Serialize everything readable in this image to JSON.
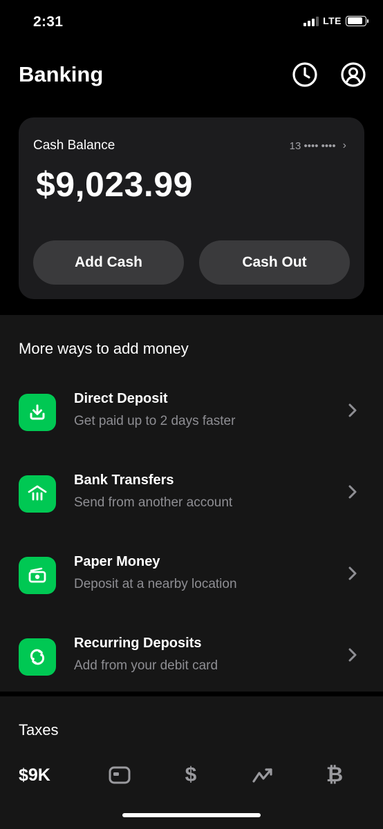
{
  "status_bar": {
    "time": "2:31",
    "network": "LTE",
    "battery_level": 0.85
  },
  "header": {
    "title": "Banking",
    "icons": [
      "history-icon",
      "profile-icon"
    ]
  },
  "balance_card": {
    "label": "Cash Balance",
    "account_mask": "13 •••• ••••",
    "amount": "$9,023.99",
    "add_cash_label": "Add Cash",
    "cash_out_label": "Cash Out"
  },
  "add_money": {
    "title": "More ways to add money",
    "items": [
      {
        "title": "Direct Deposit",
        "subtitle": "Get paid up to 2 days faster",
        "icon": "download-icon"
      },
      {
        "title": "Bank Transfers",
        "subtitle": "Send from another account",
        "icon": "bank-icon"
      },
      {
        "title": "Paper Money",
        "subtitle": "Deposit at a nearby location",
        "icon": "cash-icon"
      },
      {
        "title": "Recurring Deposits",
        "subtitle": "Add from your debit card",
        "icon": "recurring-icon"
      }
    ]
  },
  "taxes": {
    "title": "Taxes"
  },
  "bottom_nav": {
    "balance": "$9K",
    "dollar": "$",
    "bitcoin": "₿",
    "icons": [
      "card-icon",
      "dollar-icon",
      "investing-icon",
      "bitcoin-icon"
    ]
  },
  "colors": {
    "accent": "#00c853",
    "background": "#000000",
    "card": "#1c1c1e",
    "button": "#3a3a3c",
    "muted": "#8e8e93"
  }
}
